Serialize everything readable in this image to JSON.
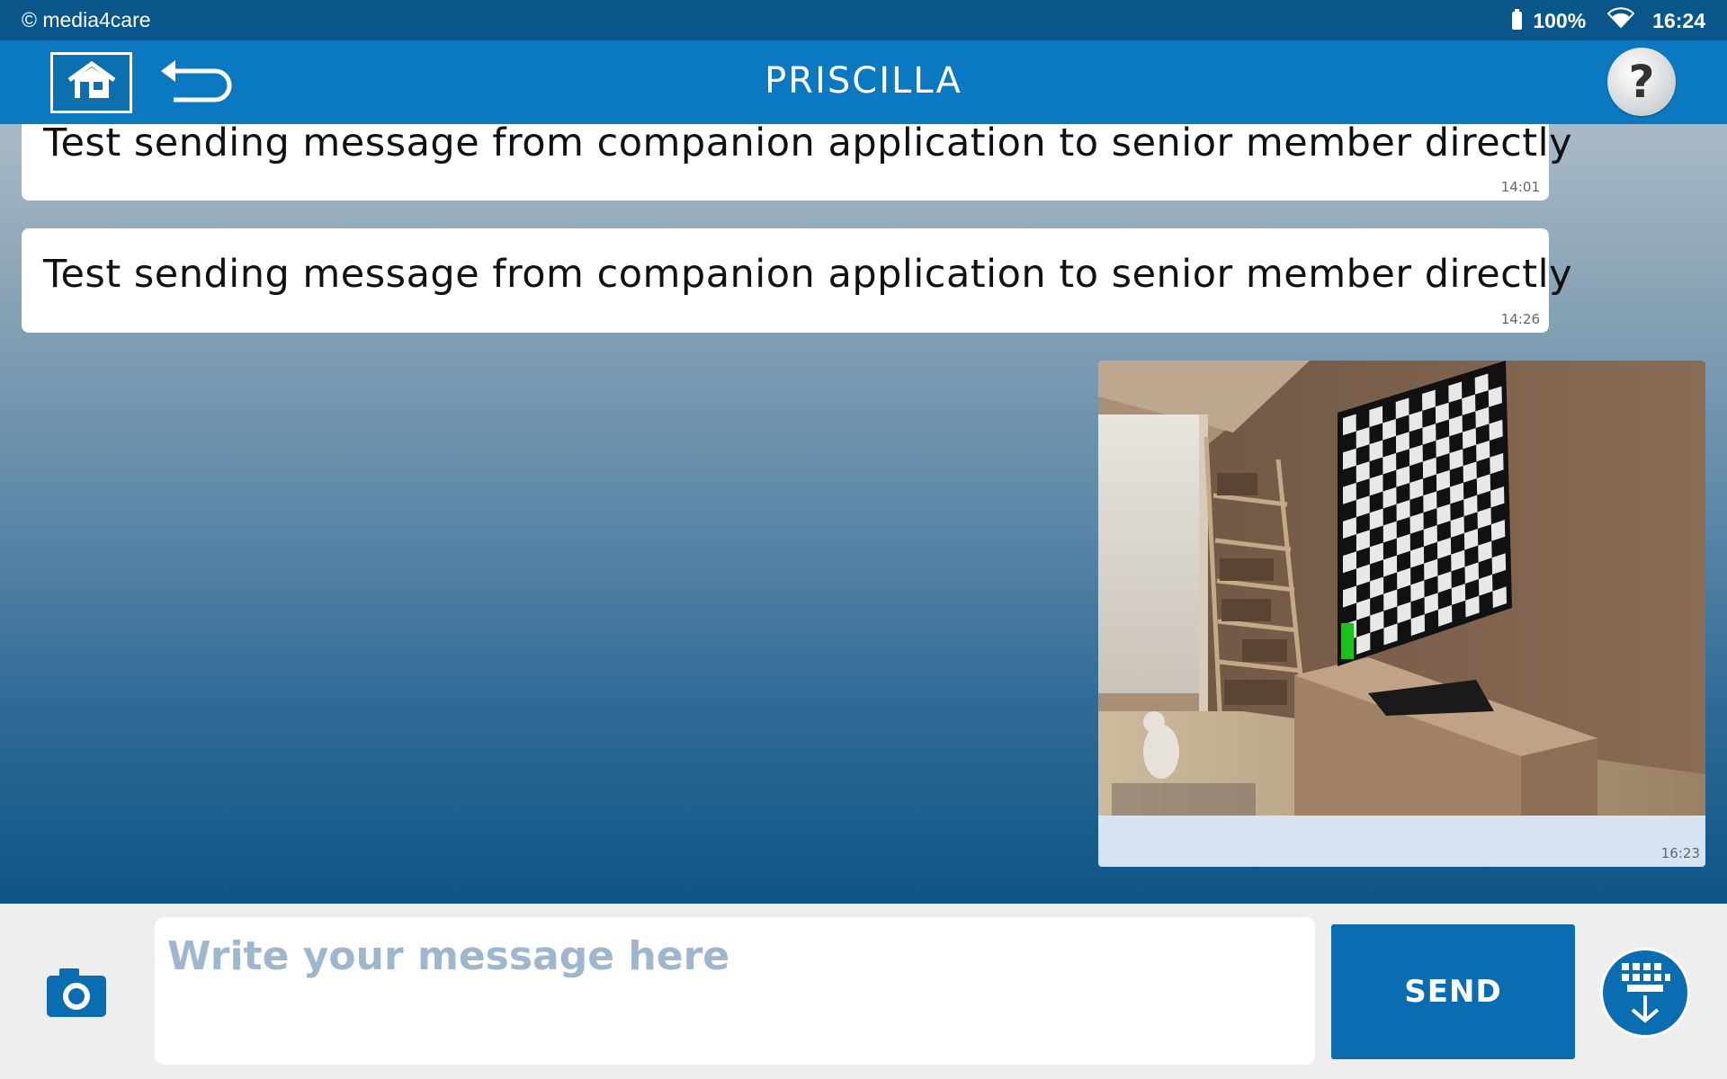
{
  "status_bar": {
    "copyright": "© media4care",
    "battery": "100%",
    "time": "16:24"
  },
  "header": {
    "title": "PRISCILLA"
  },
  "messages": [
    {
      "text": "Test sending message from companion application to senior member directly",
      "time": "14:01"
    },
    {
      "text": "Test sending message from companion application to senior member directly",
      "time": "14:26"
    }
  ],
  "image_message": {
    "time": "16:23"
  },
  "composer": {
    "placeholder": "Write your message here",
    "value": "",
    "send_label": "SEND"
  },
  "icons": {
    "home": "home-icon",
    "back": "back-arrow-icon",
    "help": "help-icon",
    "camera": "camera-icon",
    "keyboard": "keyboard-hide-icon",
    "battery": "battery-icon",
    "wifi": "wifi-icon"
  },
  "colors": {
    "status_bar": "#0a558a",
    "app_bar": "#0a79c1",
    "accent": "#0a6cb1",
    "placeholder": "#9fb6cf"
  }
}
